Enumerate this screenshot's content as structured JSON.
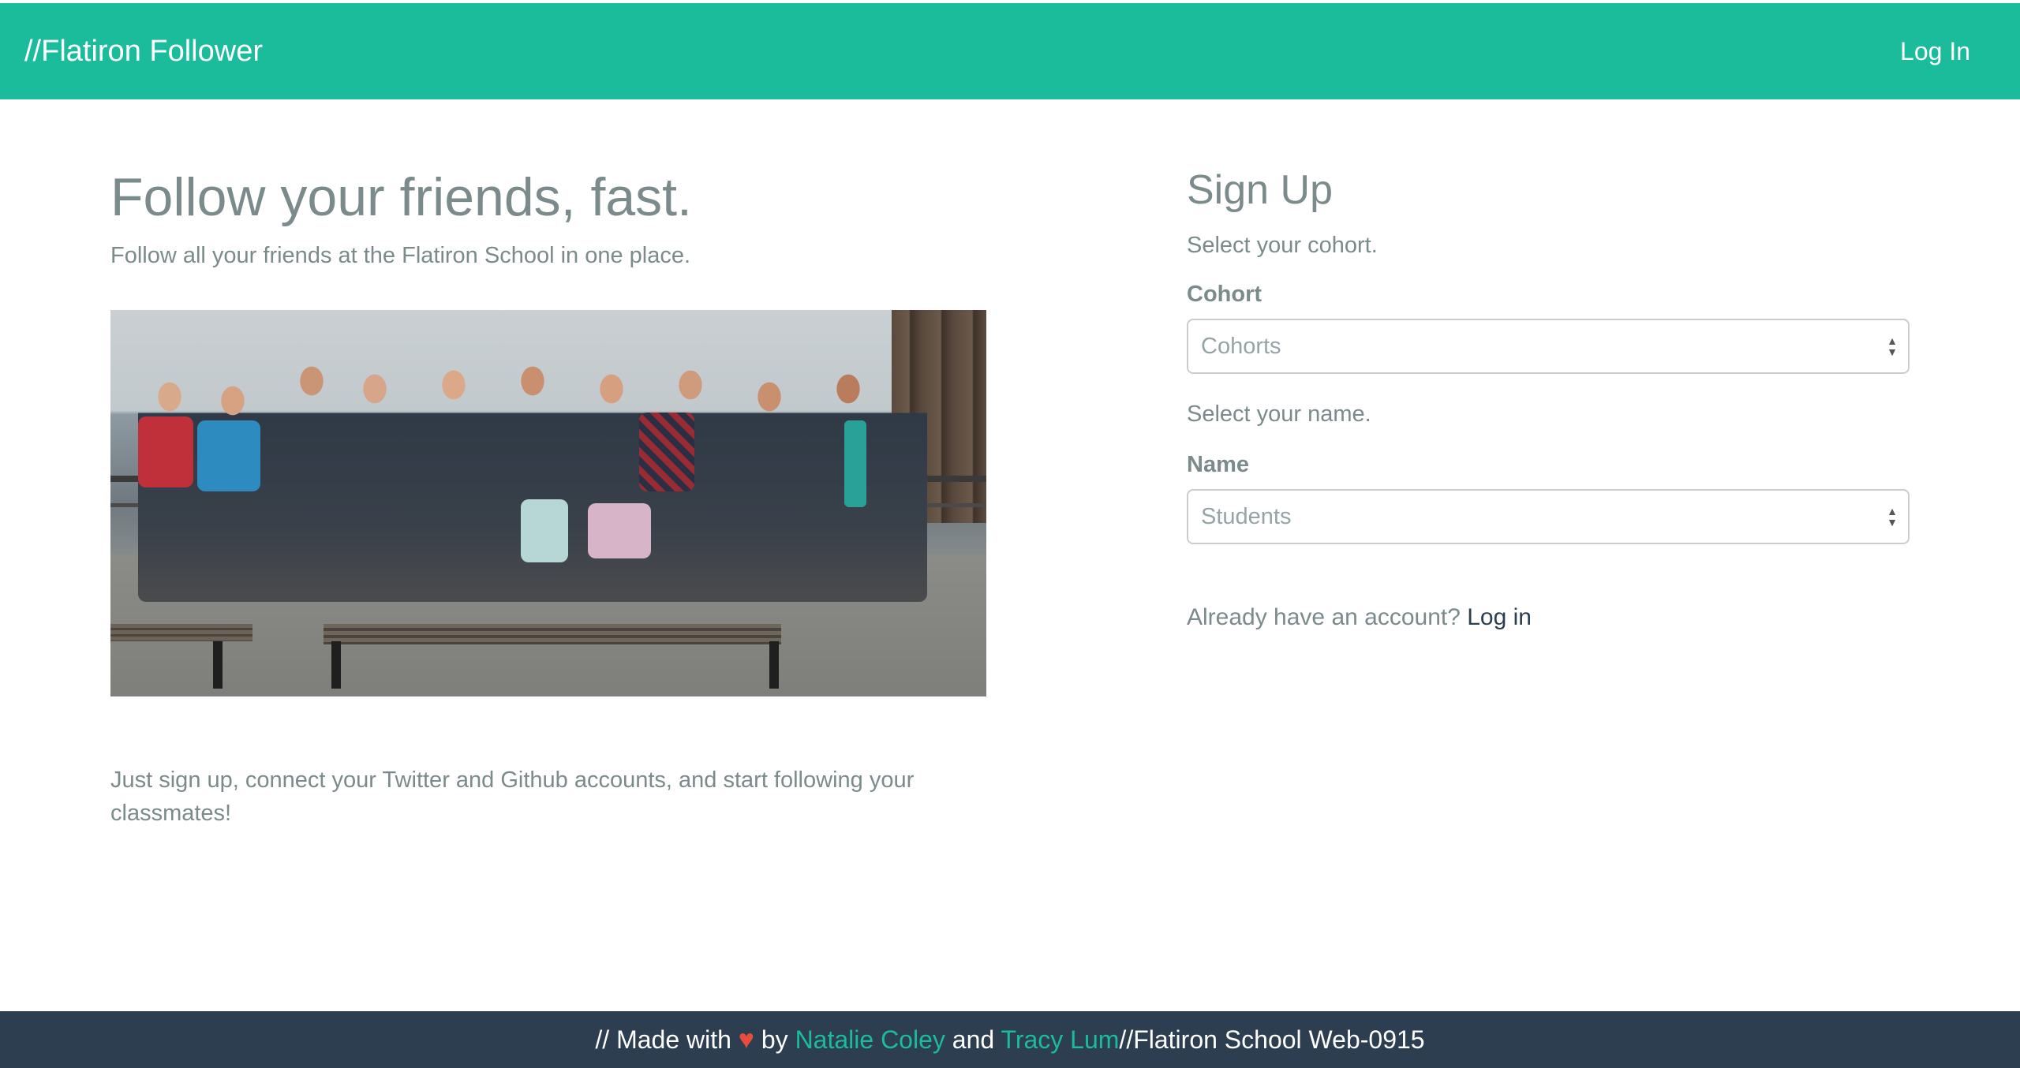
{
  "navbar": {
    "brand": "//Flatiron Follower",
    "login_link": "Log In",
    "background": "#1abc9c"
  },
  "hero": {
    "title": "Follow your friends, fast.",
    "subtitle": "Follow all your friends at the Flatiron School in one place.",
    "photo_alt": "group-photo",
    "footer_text": "Just sign up, connect your Twitter and Github accounts, and start following your classmates!"
  },
  "signup": {
    "title": "Sign Up",
    "cohort_help": "Select your cohort.",
    "cohort_label": "Cohort",
    "cohort_value": "Cohorts",
    "name_help": "Select your name.",
    "name_label": "Name",
    "name_value": "Students",
    "already_text": "Already have an account?",
    "login_link": "Log in"
  },
  "footer": {
    "prefix": "// Made with",
    "heart_icon": "heart-icon",
    "by": "by",
    "author1": "Natalie Coley",
    "and": "and",
    "author2": "Tracy Lum",
    "suffix": "//Flatiron School Web-0915",
    "background": "#2c3e50"
  }
}
